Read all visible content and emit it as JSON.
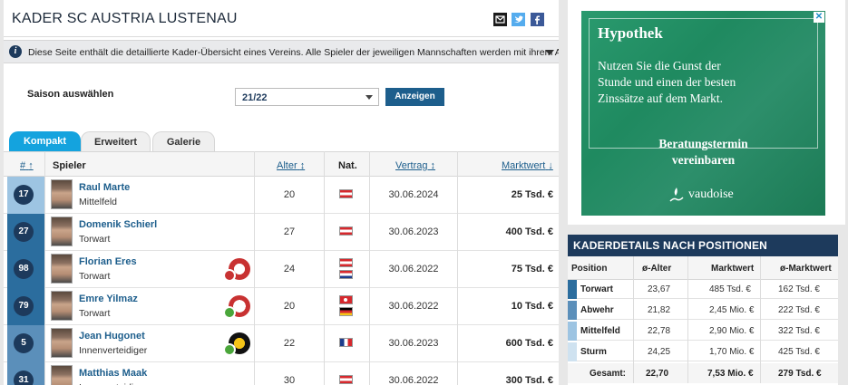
{
  "header": {
    "title": "KADER SC AUSTRIA LUSTENAU"
  },
  "info": {
    "text": "Diese Seite enthält die detaillierte Kader-Übersicht eines Vereins. Alle Spieler der jeweiligen Mannschaften werden mit ihrem Alter, der Natio..."
  },
  "season": {
    "label": "Saison auswählen",
    "selected": "21/22",
    "button_label": "Anzeigen"
  },
  "tabs": [
    {
      "label": "Kompakt"
    },
    {
      "label": "Erweitert"
    },
    {
      "label": "Galerie"
    }
  ],
  "table": {
    "headers": {
      "num": "#",
      "player": "Spieler",
      "age": "Alter",
      "nat": "Nat.",
      "contract": "Vertrag",
      "value": "Marktwert"
    },
    "sort_indicators": {
      "num": "↑",
      "age": "↕",
      "contract": "↕",
      "value": "↓"
    },
    "rows": [
      {
        "num": "17",
        "name": "Raul Marte",
        "position": "Mittelfeld",
        "age": "20",
        "contract": "30.06.2024",
        "value": "25 Tsd. €",
        "flags": [
          "aut"
        ],
        "pos_color": "#9dc4e2",
        "club": ""
      },
      {
        "num": "27",
        "name": "Domenik Schierl",
        "position": "Torwart",
        "age": "27",
        "contract": "30.06.2023",
        "value": "400 Tsd. €",
        "flags": [
          "aut"
        ],
        "pos_color": "#2b6d9e",
        "club": ""
      },
      {
        "num": "98",
        "name": "Florian Eres",
        "position": "Torwart",
        "age": "24",
        "contract": "30.06.2022",
        "value": "75 Tsd. €",
        "flags": [
          "aut",
          "hrv"
        ],
        "pos_color": "#2b6d9e",
        "club": "out"
      },
      {
        "num": "79",
        "name": "Emre Yilmaz",
        "position": "Torwart",
        "age": "20",
        "contract": "30.06.2022",
        "value": "10 Tsd. €",
        "flags": [
          "tur",
          "ger"
        ],
        "pos_color": "#2b6d9e",
        "club": "in-red"
      },
      {
        "num": "5",
        "name": "Jean Hugonet",
        "position": "Innenverteidiger",
        "age": "22",
        "contract": "30.06.2023",
        "value": "600 Tsd. €",
        "flags": [
          "fra"
        ],
        "pos_color": "#5b8fba",
        "club": "in-yellow"
      },
      {
        "num": "31",
        "name": "Matthias Maak",
        "position": "Innenverteidiger",
        "age": "30",
        "contract": "30.06.2022",
        "value": "300 Tsd. €",
        "flags": [
          "aut"
        ],
        "pos_color": "#5b8fba",
        "club": ""
      }
    ]
  },
  "ad": {
    "title": "Hypothek",
    "text": "Nutzen Sie die Gunst der Stunde und einen der besten Zinssätze auf dem Markt.",
    "cta": "Beratungstermin vereinbaren",
    "brand": "vaudoise",
    "close_label": "✕"
  },
  "kaderdetails": {
    "title": "KADERDETAILS NACH POSITIONEN",
    "headers": {
      "position": "Position",
      "avg_age": "ø-Alter",
      "value": "Marktwert",
      "avg_value": "ø-Marktwert"
    },
    "rows": [
      {
        "position": "Torwart",
        "avg_age": "23,67",
        "value": "485 Tsd. €",
        "avg_value": "162 Tsd. €",
        "color": "#2b6d9e"
      },
      {
        "position": "Abwehr",
        "avg_age": "21,82",
        "value": "2,45 Mio. €",
        "avg_value": "222 Tsd. €",
        "color": "#5b8fba"
      },
      {
        "position": "Mittelfeld",
        "avg_age": "22,78",
        "value": "2,90 Mio. €",
        "avg_value": "322 Tsd. €",
        "color": "#9dc4e2"
      },
      {
        "position": "Sturm",
        "avg_age": "24,25",
        "value": "1,70 Mio. €",
        "avg_value": "425 Tsd. €",
        "color": "#cfe2f0"
      }
    ],
    "total": {
      "label": "Gesamt:",
      "avg_age": "22,70",
      "value": "7,53 Mio. €",
      "avg_value": "279 Tsd. €"
    }
  }
}
